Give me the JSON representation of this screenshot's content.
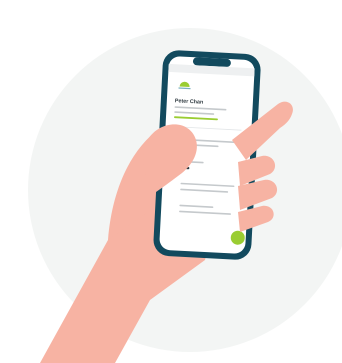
{
  "illustration": {
    "name": "Peter Chan",
    "colors": {
      "background_circle": "#f3f5f4",
      "skin": "#f7b3a3",
      "phone_frame": "#124a5e",
      "screen": "#ffffff",
      "accent_green": "#9acd32",
      "text_dark": "#2f3a40",
      "text_light": "#c5c9cc"
    },
    "icons": [
      "sun-logo-icon",
      "floating-action-button-icon"
    ]
  }
}
